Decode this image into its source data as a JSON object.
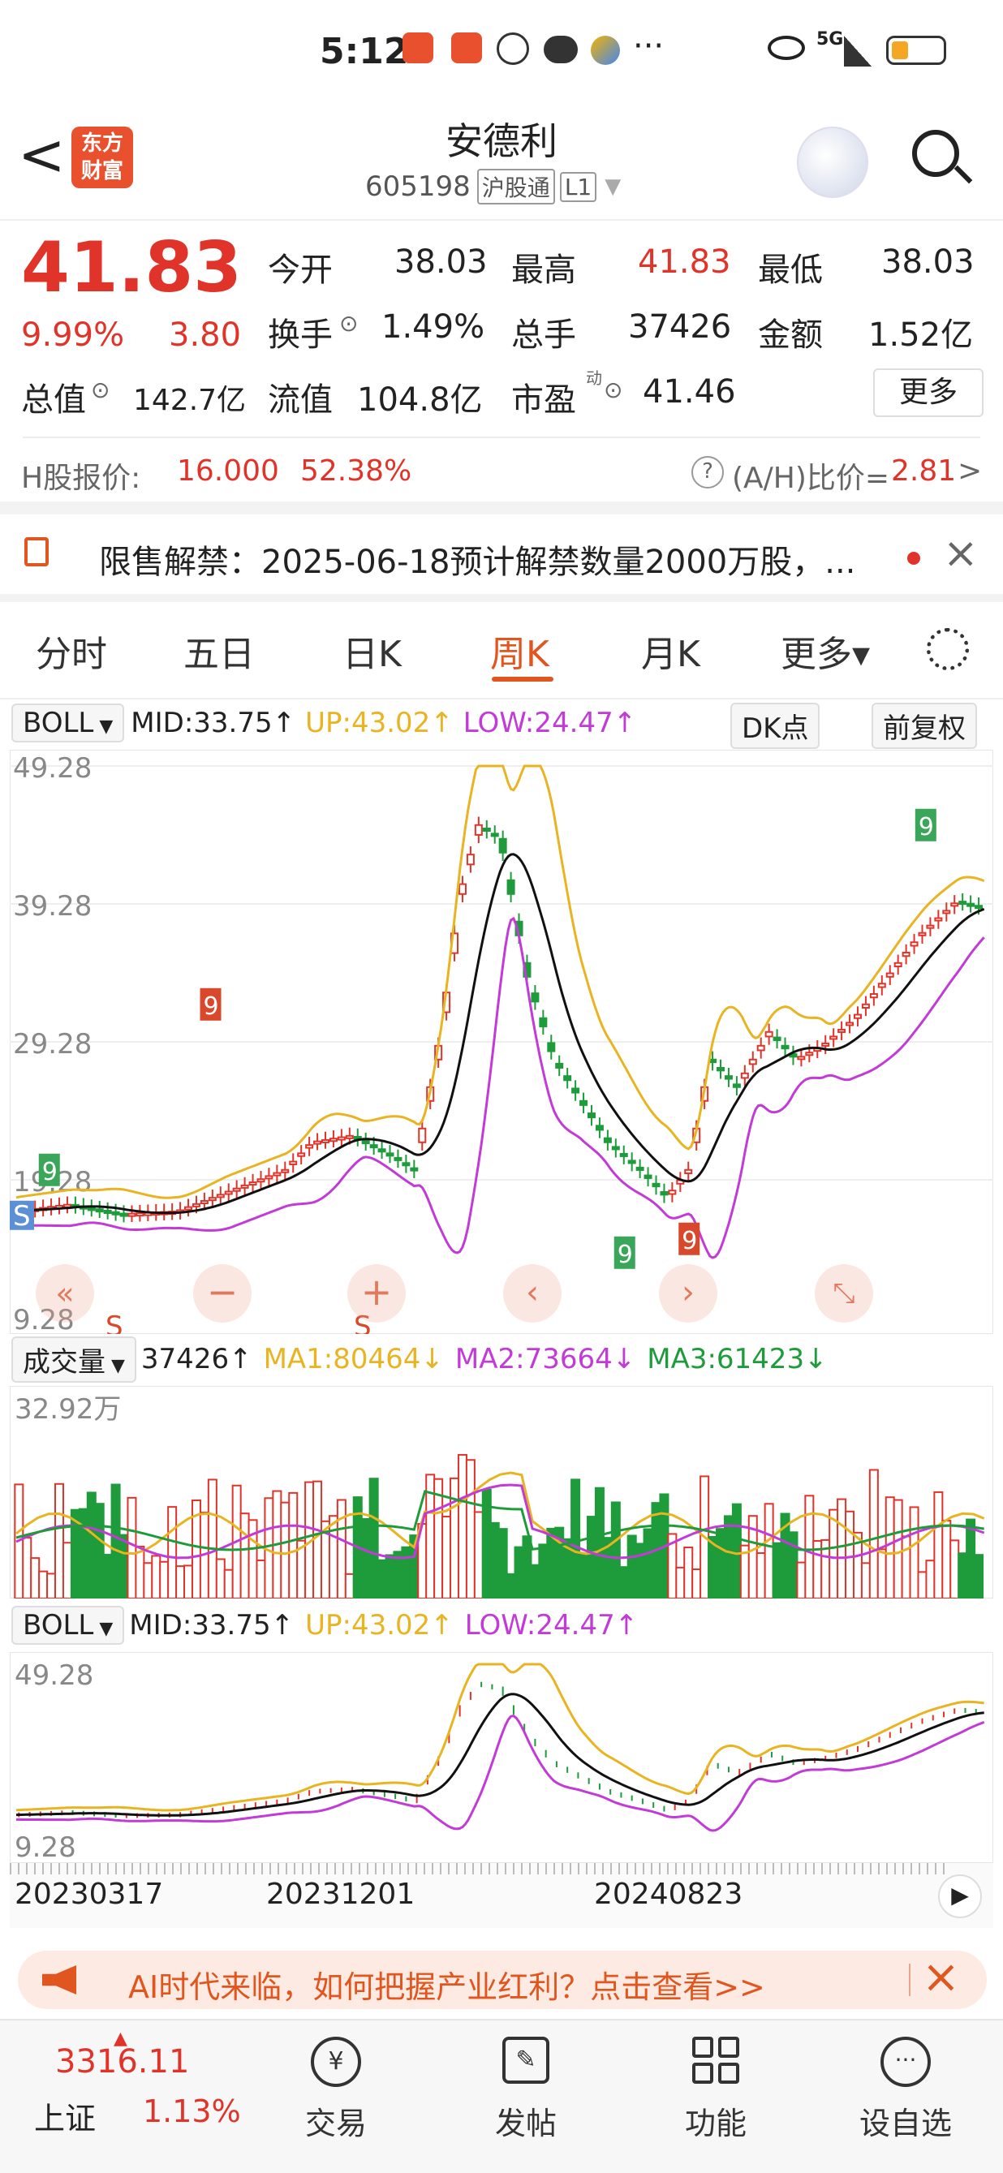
{
  "status": {
    "time": "5:12",
    "network": "5G",
    "dots": "···"
  },
  "header": {
    "back": "<",
    "logo_line1": "东方",
    "logo_line2": "财富",
    "name": "安德利",
    "code": "605198",
    "tag1": "沪股通",
    "tag2": "L1"
  },
  "quote": {
    "price": "41.83",
    "change_pct": "9.99%",
    "change": "3.80",
    "open_label": "今开",
    "open": "38.03",
    "high_label": "最高",
    "high": "41.83",
    "low_label": "最低",
    "low": "38.03",
    "turnover_label": "换手",
    "turnover": "1.49%",
    "volume_label": "总手",
    "volume": "37426",
    "amount_label": "金额",
    "amount": "1.52亿",
    "mktcap_label": "总值",
    "mktcap": "142.7亿",
    "float_label": "流值",
    "float": "104.8亿",
    "pe_label": "市盈",
    "pe_sup": "动",
    "pe": "41.46",
    "more_button": "更多"
  },
  "hshare": {
    "label": "H股报价:",
    "price": "16.000",
    "premium": "52.38%",
    "ratio_label": "(A/H)比价=",
    "ratio": "2.81",
    "arrow": ">"
  },
  "notice": {
    "text": "限售解禁：2025-06-18预计解禁数量2000万股，..."
  },
  "tabs": [
    {
      "label": "分时"
    },
    {
      "label": "五日"
    },
    {
      "label": "日K"
    },
    {
      "label": "周K"
    },
    {
      "label": "月K"
    },
    {
      "label": "更多▾"
    }
  ],
  "boll": {
    "name": "BOLL",
    "mid": "MID:33.75↑",
    "up": "UP:43.02↑",
    "low": "LOW:24.47↑",
    "dk_button": "DK点",
    "fq_button": "前复权"
  },
  "kchart": {
    "y_labels": [
      "49.28",
      "39.28",
      "29.28",
      "19.28",
      "9.28"
    ],
    "s_markers": [
      "S",
      "S",
      "S"
    ],
    "nines": [
      "9",
      "9",
      "9",
      "9",
      "9"
    ]
  },
  "volume": {
    "name": "成交量",
    "value": "37426↑",
    "ma1": "MA1:80464↓",
    "ma2": "MA2:73664↓",
    "ma3": "MA3:61423↓",
    "max_label": "32.92万"
  },
  "boll2": {
    "name": "BOLL",
    "mid": "MID:33.75↑",
    "up": "UP:43.02↑",
    "low": "LOW:24.47↑",
    "y_top": "49.28",
    "y_bottom": "9.28"
  },
  "dates": [
    "20230317",
    "20231201",
    "20240823"
  ],
  "ad": {
    "text": "AI时代来临，如何把握产业红利？点击查看>>"
  },
  "bottom": {
    "index_value": "3316.11",
    "index_name": "上证",
    "index_change": "1.13%",
    "trade": "交易",
    "post": "发帖",
    "function": "功能",
    "watchlist": "设自选"
  },
  "colors": {
    "red": "#e0342a",
    "green": "#1e9b3a",
    "up_line": "#e8b422",
    "low_line": "#c23bd6",
    "mid_line": "#111111",
    "accent": "#e0561e"
  }
}
